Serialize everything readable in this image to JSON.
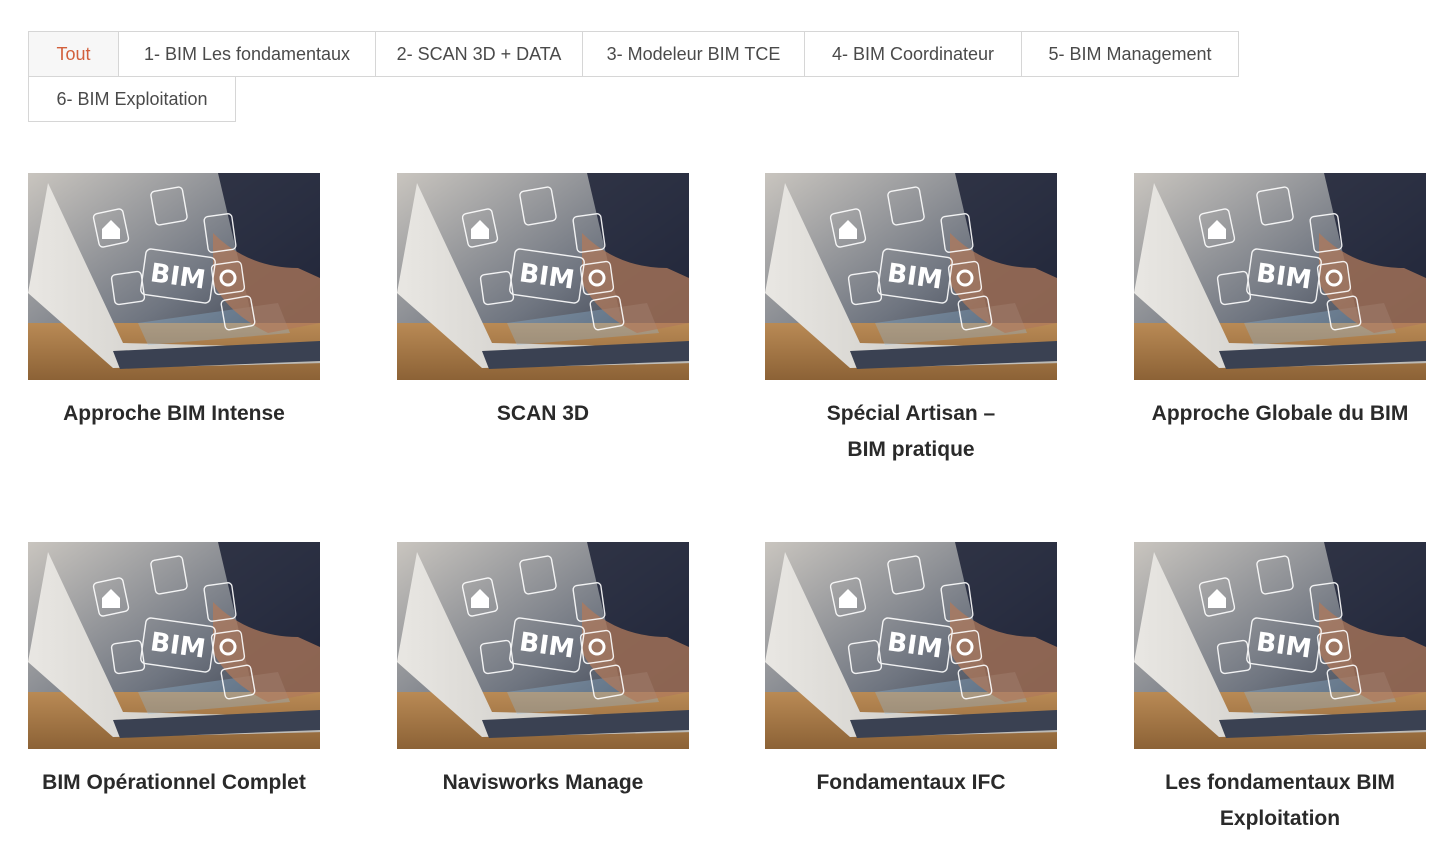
{
  "filters": [
    {
      "label": "Tout",
      "active": true
    },
    {
      "label": "1- BIM Les fondamentaux",
      "active": false
    },
    {
      "label": "2- SCAN 3D + DATA",
      "active": false
    },
    {
      "label": "3- Modeleur BIM TCE",
      "active": false
    },
    {
      "label": "4- BIM Coordinateur",
      "active": false
    },
    {
      "label": "5- BIM Management",
      "active": false
    },
    {
      "label": "6- BIM Exploitation",
      "active": false
    }
  ],
  "courses": [
    {
      "title": "Approche BIM Intense",
      "image_text": "BIM"
    },
    {
      "title": "SCAN 3D",
      "image_text": "BIM"
    },
    {
      "title": "Spécial Artisan – BIM pratique",
      "image_text": "BIM"
    },
    {
      "title": "Approche Globale du BIM",
      "image_text": "BIM"
    },
    {
      "title": "BIM Opérationnel Complet",
      "image_text": "BIM"
    },
    {
      "title": "Navisworks Manage",
      "image_text": "BIM"
    },
    {
      "title": "Fondamentaux IFC",
      "image_text": "BIM"
    },
    {
      "title": "Les fondamentaux BIM Exploitation",
      "image_text": "BIM"
    }
  ],
  "colors": {
    "active_tab": "#d2603c",
    "border": "#d6d6d6",
    "title": "#2a2a2a"
  }
}
